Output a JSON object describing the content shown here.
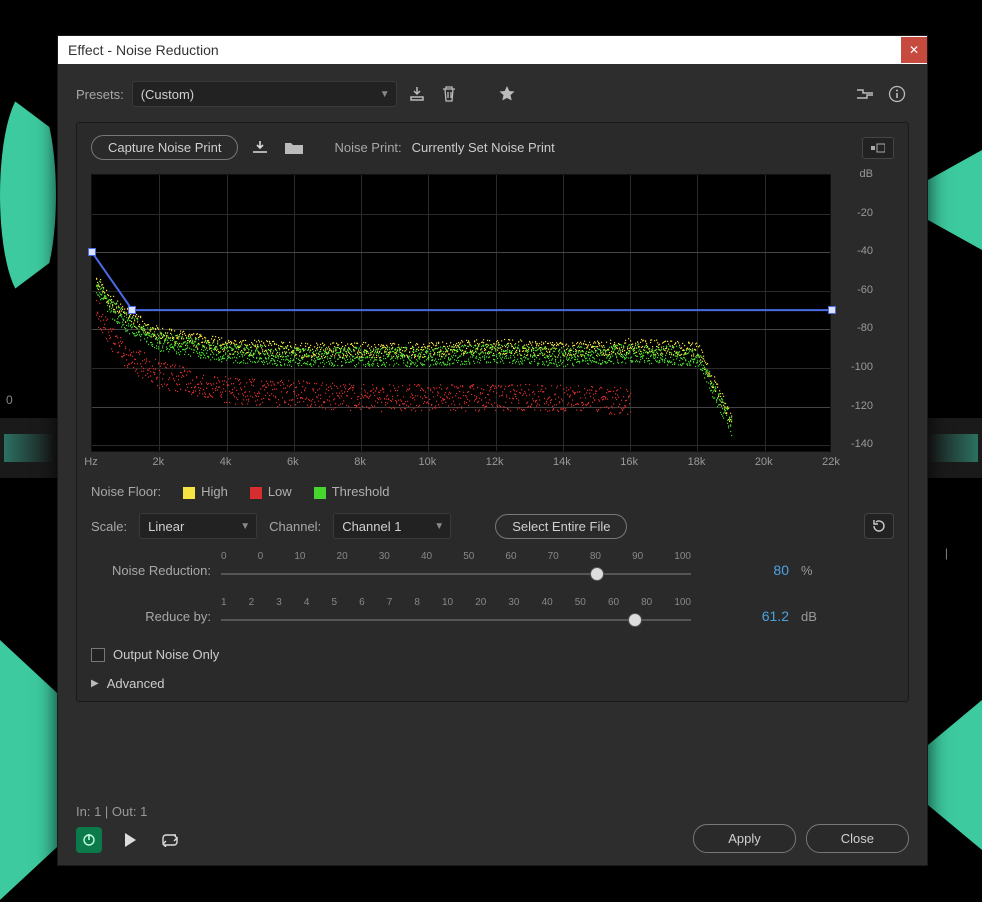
{
  "window": {
    "title": "Effect - Noise Reduction",
    "close": "✕"
  },
  "presets": {
    "label": "Presets:",
    "value": "(Custom)"
  },
  "toolbar": {
    "save_icon": "save-preset",
    "delete_icon": "delete-preset",
    "fav_icon": "favorite"
  },
  "header_right": {
    "routing_icon": "routing",
    "info_icon": "info"
  },
  "capture": {
    "button": "Capture Noise Print",
    "download_icon": "save-noise-print",
    "folder_icon": "open-noise-print",
    "status_label": "Noise Print:",
    "status_value": "Currently Set Noise Print",
    "view_btn": "view-toggle"
  },
  "legend": {
    "label": "Noise Floor:",
    "high": "High",
    "high_color": "#f5e442",
    "low": "Low",
    "low_color": "#d62e2e",
    "threshold": "Threshold",
    "threshold_color": "#47d62e"
  },
  "scale": {
    "label": "Scale:",
    "value": "Linear"
  },
  "channel": {
    "label": "Channel:",
    "value": "Channel 1"
  },
  "select_file": "Select Entire File",
  "reset_icon": "reset",
  "noise_reduction": {
    "label": "Noise Reduction:",
    "value": "80",
    "unit": "%"
  },
  "reduce_by": {
    "label": "Reduce by:",
    "value": "61.2",
    "unit": "dB"
  },
  "output_noise": {
    "label": "Output Noise Only"
  },
  "advanced": {
    "label": "Advanced"
  },
  "io": {
    "text": "In: 1 | Out: 1"
  },
  "footer": {
    "power": "power",
    "play": "play",
    "loop": "loop",
    "apply": "Apply",
    "close": "Close"
  },
  "chart_data": {
    "type": "line",
    "title": "",
    "xlabel": "Hz",
    "ylabel": "dB",
    "x_ticks": [
      "Hz",
      "2k",
      "4k",
      "6k",
      "8k",
      "10k",
      "12k",
      "14k",
      "16k",
      "18k",
      "20k",
      "22k"
    ],
    "y_ticks": [
      "dB",
      "-20",
      "-40",
      "-60",
      "-80",
      "-100",
      "-120",
      "-140"
    ],
    "xlim": [
      0,
      22000
    ],
    "ylim": [
      -144,
      0
    ],
    "series": [
      {
        "name": "High (noise floor)",
        "color": "#f5e442",
        "x": [
          100,
          500,
          1000,
          2000,
          4000,
          6000,
          8000,
          10000,
          12000,
          14000,
          16000,
          18000,
          19000,
          20000,
          22000
        ],
        "values": [
          -55,
          -66,
          -74,
          -84,
          -90,
          -92,
          -92,
          -92,
          -90,
          -92,
          -90,
          -92,
          -128,
          null,
          null
        ]
      },
      {
        "name": "Threshold (green)",
        "color": "#47d62e",
        "x": [
          100,
          500,
          1000,
          2000,
          4000,
          6000,
          8000,
          10000,
          12000,
          14000,
          16000,
          18000,
          19000,
          20000,
          22000
        ],
        "values": [
          -58,
          -70,
          -78,
          -88,
          -94,
          -96,
          -96,
          -96,
          -94,
          -96,
          -94,
          -96,
          -132,
          null,
          null
        ]
      },
      {
        "name": "Low (noise floor)",
        "color": "#d62e2e",
        "x": [
          100,
          500,
          1000,
          2000,
          4000,
          6000,
          8000,
          10000,
          12000,
          14000,
          16000,
          18000,
          19000,
          20000,
          22000
        ],
        "values": [
          -72,
          -86,
          -96,
          -106,
          -114,
          -116,
          -118,
          -118,
          -118,
          -118,
          -120,
          null,
          null,
          null,
          null
        ]
      },
      {
        "name": "Threshold control (blue)",
        "color": "#4a6ae6",
        "x": [
          0,
          1200,
          22000
        ],
        "values": [
          -40,
          -70,
          -70
        ]
      }
    ],
    "control_points": [
      {
        "x": 0,
        "y": -40
      },
      {
        "x": 1200,
        "y": -70
      },
      {
        "x": 22000,
        "y": -70
      }
    ]
  },
  "nr_ticks": [
    "0",
    "0",
    "10",
    "20",
    "30",
    "40",
    "50",
    "60",
    "70",
    "80",
    "90",
    "100"
  ],
  "rb_ticks": [
    "1",
    "2",
    "3",
    "4",
    "5",
    "6",
    "7",
    "8",
    "10",
    "20",
    "30",
    "40",
    "50",
    "60",
    "80",
    "100"
  ]
}
